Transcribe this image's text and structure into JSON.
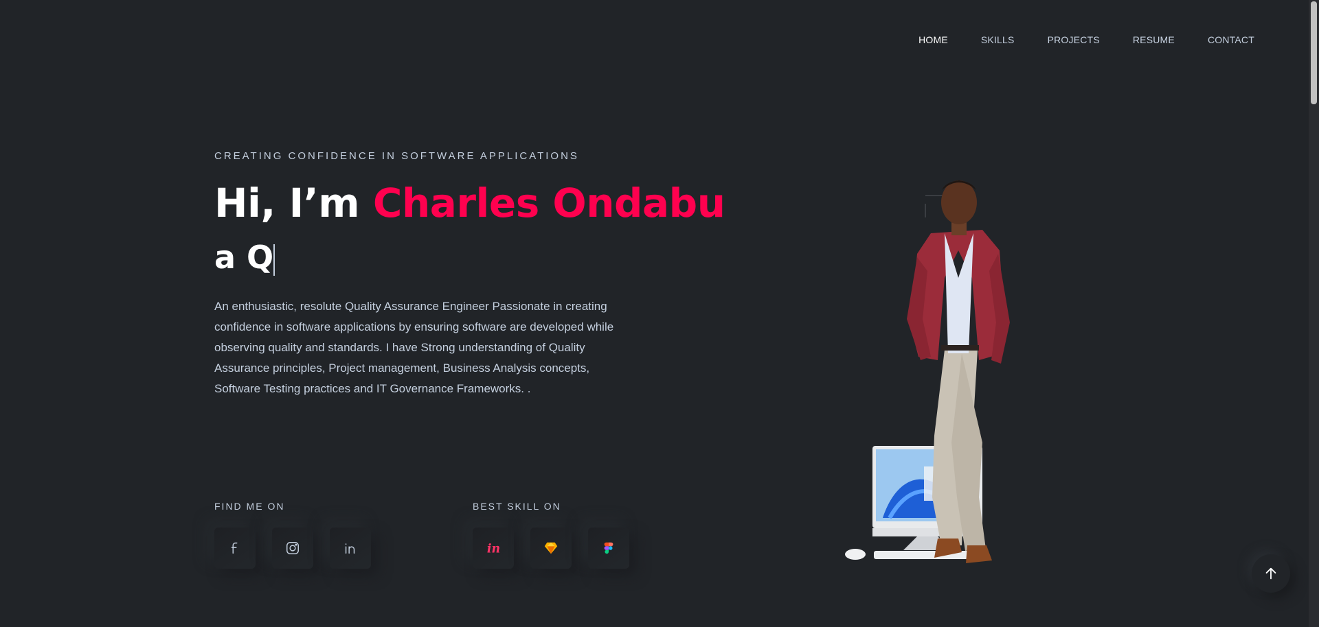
{
  "nav": {
    "items": [
      {
        "label": "HOME",
        "active": true
      },
      {
        "label": "SKILLS",
        "active": false
      },
      {
        "label": "PROJECTS",
        "active": false
      },
      {
        "label": "RESUME",
        "active": false
      },
      {
        "label": "CONTACT",
        "active": false
      }
    ]
  },
  "hero": {
    "tagline": "CREATING CONFIDENCE IN SOFTWARE APPLICATIONS",
    "greeting": "Hi, I’m ",
    "name": "Charles Ondabu",
    "typed_text": "a Q",
    "bio": "An enthusiastic, resolute Quality Assurance Engineer Passionate in creating confidence in software applications by ensuring software are developed while observing quality and standards. I have Strong understanding of Quality Assurance principles, Project management, Business Analysis concepts, Software Testing practices and IT Governance Frameworks. ."
  },
  "social": {
    "title": "FIND ME ON",
    "icons": [
      "facebook-icon",
      "instagram-icon",
      "linkedin-icon"
    ]
  },
  "skills": {
    "title": "BEST SKILL ON",
    "icons": [
      "invision-icon",
      "sketch-icon",
      "figma-icon"
    ]
  },
  "colors": {
    "background": "#212428",
    "accent": "#ff014f",
    "text": "#c4cfde",
    "heading": "#ffffff"
  }
}
